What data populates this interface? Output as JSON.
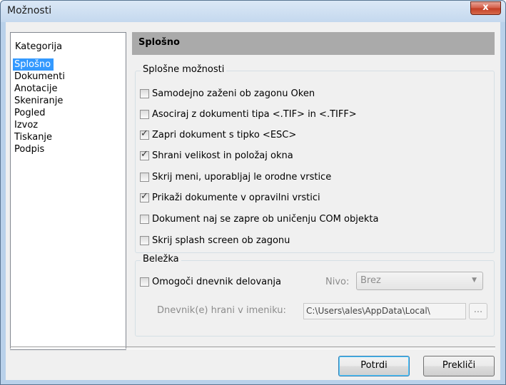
{
  "window": {
    "title": "Možnosti",
    "close_label": "x"
  },
  "sidebar": {
    "header": "Kategorija",
    "items": [
      {
        "label": "Splošno",
        "selected": true
      },
      {
        "label": "Dokumenti"
      },
      {
        "label": "Anotacije"
      },
      {
        "label": "Skeniranje"
      },
      {
        "label": "Pogled"
      },
      {
        "label": "Izvoz"
      },
      {
        "label": "Tiskanje"
      },
      {
        "label": "Podpis"
      }
    ]
  },
  "main": {
    "header": "Splošno",
    "general_group": {
      "title": "Splošne možnosti",
      "options": [
        {
          "label": "Samodejno zaženi ob zagonu Oken",
          "checked": false
        },
        {
          "label": "Asociraj z dokumenti tipa <.TIF> in <.TIFF>",
          "checked": false
        },
        {
          "label": "Zapri dokument s tipko <ESC>",
          "checked": true
        },
        {
          "label": "Shrani velikost in položaj okna",
          "checked": true
        },
        {
          "label": "Skrij meni, uporabljaj le orodne vrstice",
          "checked": false
        },
        {
          "label": "Prikaži dokumente v opravilni vrstici",
          "checked": true
        },
        {
          "label": "Dokument naj se zapre ob uničenju COM objekta",
          "checked": false
        },
        {
          "label": "Skrij splash screen ob zagonu",
          "checked": false
        }
      ]
    },
    "log_group": {
      "title": "Beležka",
      "enable_label": "Omogoči dnevnik delovanja",
      "enable_checked": false,
      "level_label": "Nivo:",
      "level_value": "Brez",
      "path_label": "Dnevnik(e) hrani v imeniku:",
      "path_value": "C:\\Users\\ales\\AppData\\Local\\",
      "browse_label": "..."
    }
  },
  "buttons": {
    "ok": "Potrdi",
    "cancel": "Prekliči"
  }
}
